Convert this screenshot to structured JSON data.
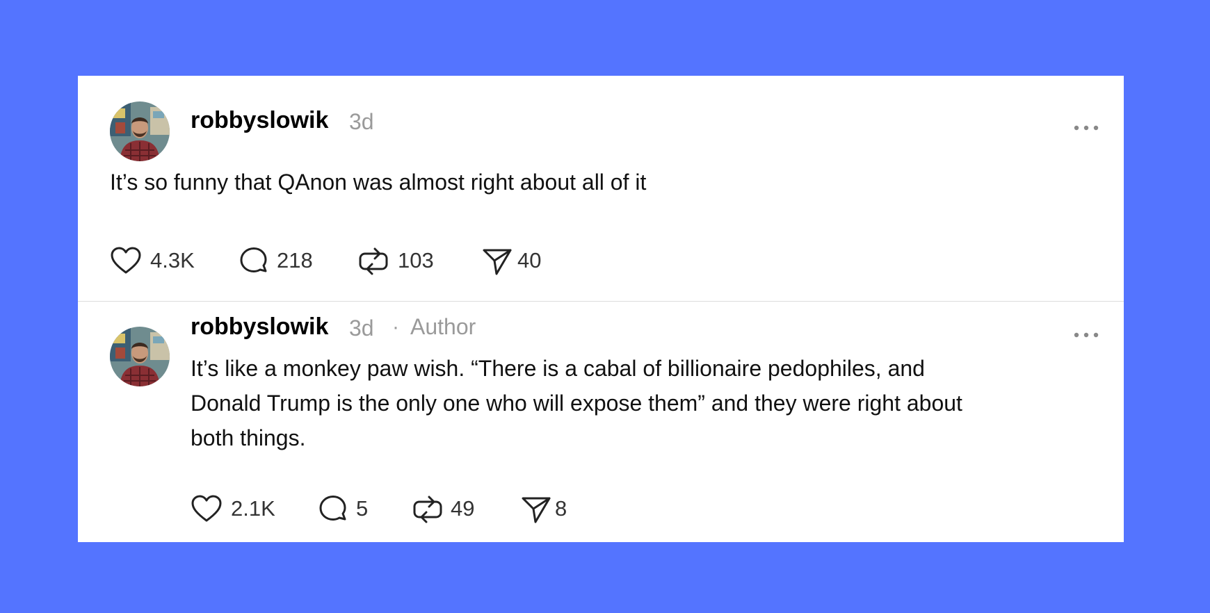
{
  "colors": {
    "background": "#5474ff",
    "card": "#ffffff",
    "muted": "#9a9a9a"
  },
  "posts": [
    {
      "username": "robbyslowik",
      "time": "3d",
      "text": "It’s so funny that QAnon was almost right about all of it",
      "stats": {
        "likes": "4.3K",
        "replies": "218",
        "reposts": "103",
        "shares": "40"
      },
      "icons": [
        "heart-icon",
        "comment-icon",
        "repost-icon",
        "share-icon",
        "more-icon"
      ]
    },
    {
      "username": "robbyslowik",
      "time": "3d",
      "separator": "·",
      "badge": "Author",
      "text_lines": [
        "It’s like a monkey paw wish. “There is a cabal of billionaire pedophiles, and",
        "Donald Trump is the only one who will expose them” and they were right about",
        "both things."
      ],
      "stats": {
        "likes": "2.1K",
        "replies": "5",
        "reposts": "49",
        "shares": "8"
      },
      "icons": [
        "heart-icon",
        "comment-icon",
        "repost-icon",
        "share-icon",
        "more-icon"
      ]
    }
  ]
}
